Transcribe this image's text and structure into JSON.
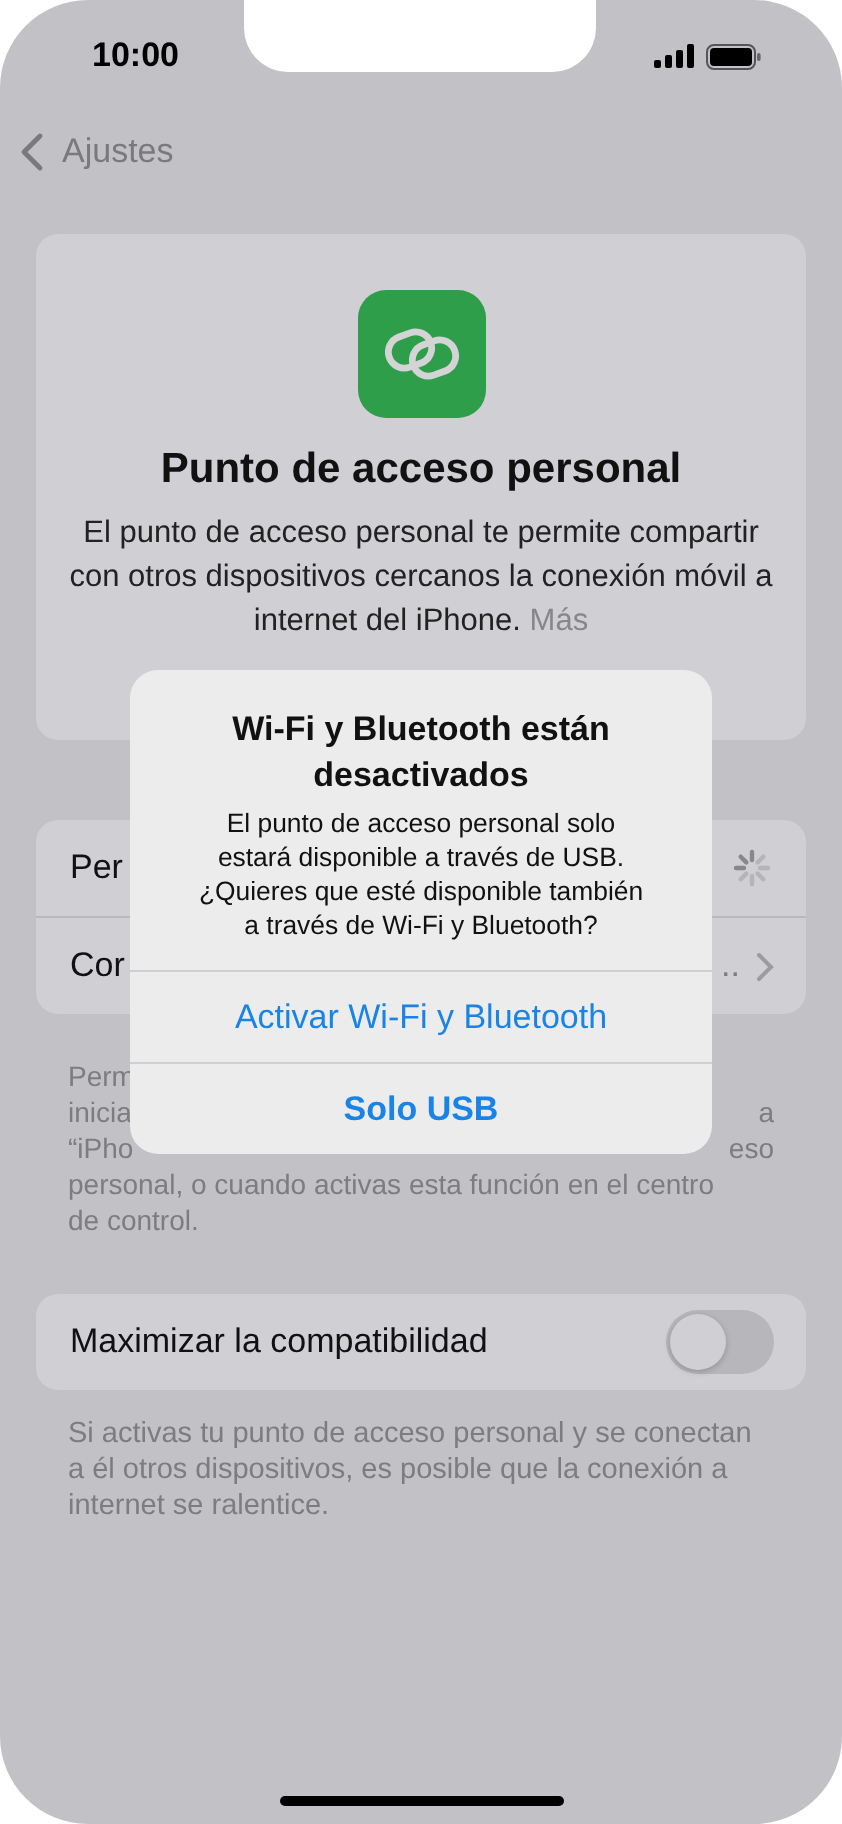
{
  "status_bar": {
    "time": "10:00"
  },
  "nav": {
    "back": "Ajustes"
  },
  "header": {
    "title": "Punto de acceso personal",
    "description": "El punto de acceso personal te permite compartir con otros dispositivos cercanos la conexión móvil a internet del iPhone.",
    "link": "Más"
  },
  "rows": [
    {
      "kind": "spinner",
      "label": "Per"
    },
    {
      "kind": "chevron",
      "label": "Cor",
      "value": ".."
    }
  ],
  "footer_lines": [
    {
      "left": "Perm"
    },
    {
      "left": "inicia",
      "right": "a"
    },
    {
      "left": "“iPho",
      "right": "eso"
    },
    {
      "left": "personal, o cuando activas esta función en el centro"
    },
    {
      "left": "de control."
    }
  ],
  "compat": {
    "label": "Maximizar la compatibilidad",
    "on": false,
    "footer": "Si activas tu punto de acceso personal y se conectan a él otros dispositivos, es posible que la conexión a internet se ralentice."
  },
  "alert": {
    "title": "Wi-Fi y Bluetooth están desactivados",
    "message": "El punto de acceso personal solo estará disponible a través de USB. ¿Quieres que esté disponible también a través de Wi-Fi y Bluetooth?",
    "buttons": [
      {
        "label": "Activar Wi-Fi y Bluetooth",
        "bold": false
      },
      {
        "label": "Solo USB",
        "bold": true
      }
    ]
  }
}
